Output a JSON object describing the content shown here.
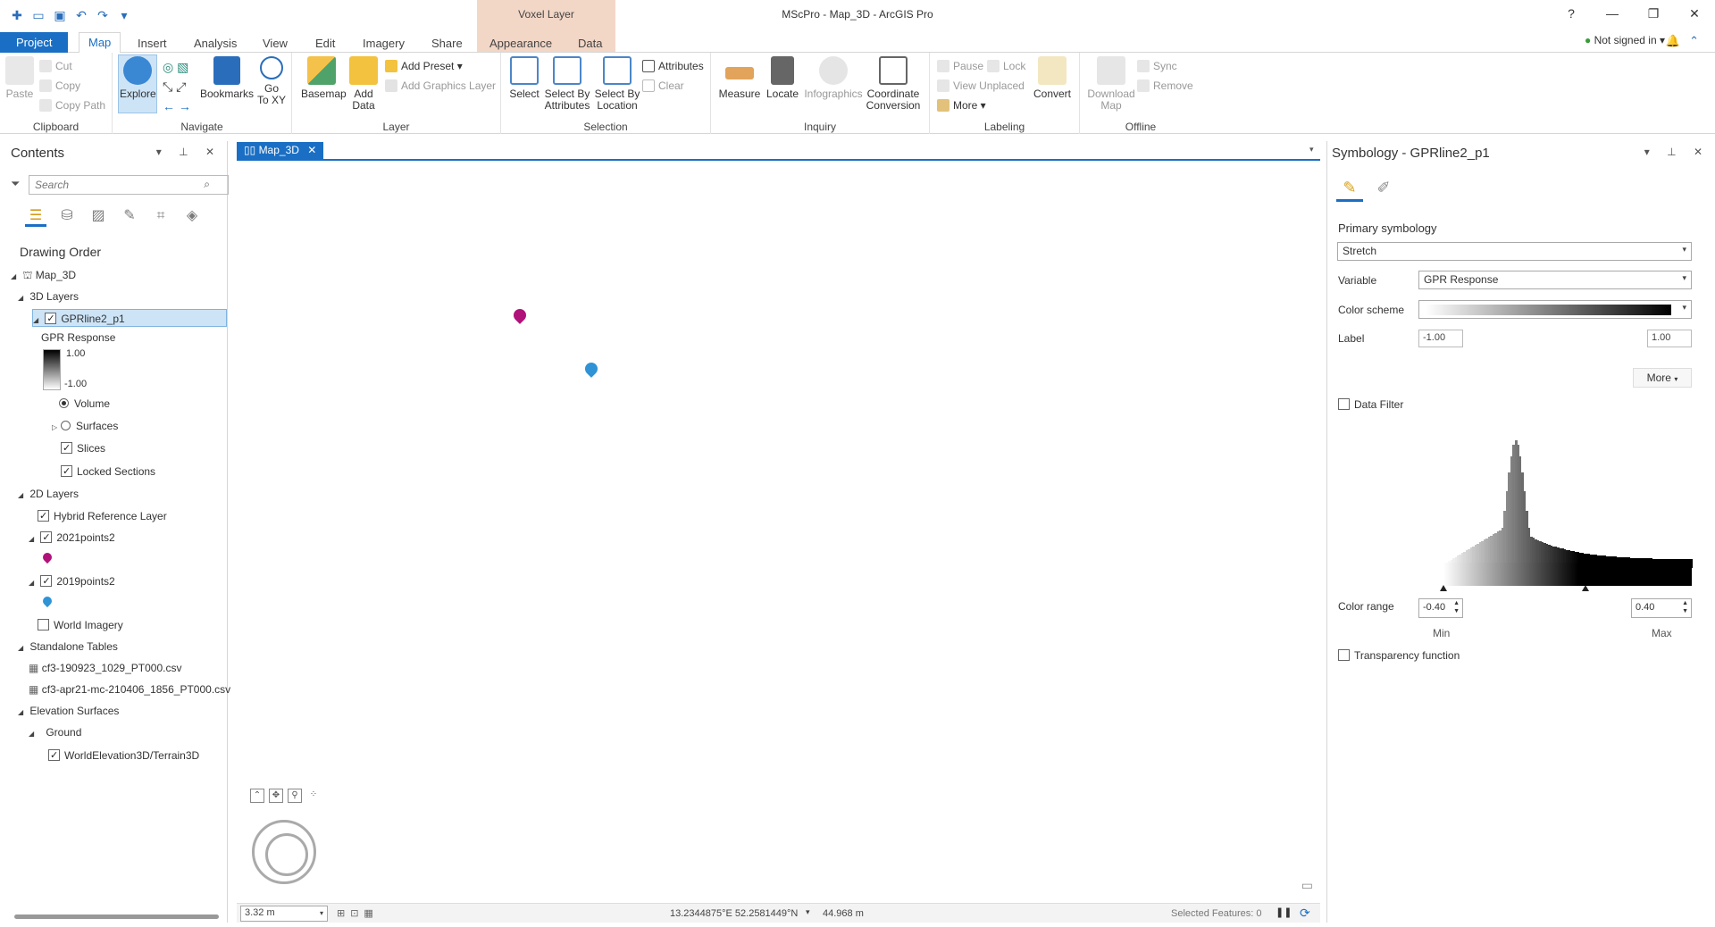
{
  "app": {
    "title": "MScPro - Map_3D - ArcGIS Pro",
    "contextual_tab_group": "Voxel Layer",
    "help": "?",
    "signin": "Not signed in",
    "signin_caret": "▾"
  },
  "tabs": [
    "Project",
    "Map",
    "Insert",
    "Analysis",
    "View",
    "Edit",
    "Imagery",
    "Share",
    "Appearance",
    "Data"
  ],
  "ribbon": {
    "clipboard": {
      "paste": "Paste",
      "cut": "Cut",
      "copy": "Copy",
      "copy_path": "Copy Path",
      "label": "Clipboard"
    },
    "navigate": {
      "explore": "Explore",
      "bookmarks": "Bookmarks",
      "go_to_xy_1": "Go",
      "go_to_xy_2": "To XY",
      "label": "Navigate"
    },
    "layer": {
      "basemap": "Basemap",
      "add_data_1": "Add",
      "add_data_2": "Data",
      "add_preset": "Add Preset",
      "add_graphics_layer": "Add Graphics Layer",
      "label": "Layer"
    },
    "selection": {
      "select": "Select",
      "select_by_attr_1": "Select By",
      "select_by_attr_2": "Attributes",
      "select_by_loc_1": "Select By",
      "select_by_loc_2": "Location",
      "attributes": "Attributes",
      "clear": "Clear",
      "label": "Selection"
    },
    "inquiry": {
      "measure": "Measure",
      "locate": "Locate",
      "infographics": "Infographics",
      "coord_conv_1": "Coordinate",
      "coord_conv_2": "Conversion",
      "label": "Inquiry"
    },
    "labeling": {
      "pause": "Pause",
      "lock": "Lock",
      "view_unplaced": "View Unplaced",
      "more": "More",
      "convert": "Convert",
      "label": "Labeling"
    },
    "offline": {
      "download_1": "Download",
      "download_2": "Map",
      "sync": "Sync",
      "remove": "Remove",
      "label": "Offline"
    }
  },
  "contents": {
    "title": "Contents",
    "search_placeholder": "Search",
    "drawing_order": "Drawing Order",
    "map": "Map_3D",
    "layers_3d": "3D Layers",
    "voxel_layer": "GPRline2_p1",
    "legend_title": "GPR Response",
    "legend_max": "1.00",
    "legend_min": "-1.00",
    "volume": "Volume",
    "surfaces": "Surfaces",
    "slices": "Slices",
    "locked_sections": "Locked Sections",
    "layers_2d": "2D Layers",
    "hybrid_ref": "Hybrid Reference Layer",
    "points_2021": "2021points2",
    "points_2019": "2019points2",
    "world_imagery": "World Imagery",
    "standalone_tables": "Standalone Tables",
    "table_1": "cf3-190923_1029_PT000.csv",
    "table_2": "cf3-apr21-mc-210406_1856_PT000.csv",
    "elevation_surfaces": "Elevation Surfaces",
    "ground": "Ground",
    "terrain": "WorldElevation3D/Terrain3D"
  },
  "map": {
    "tab": "Map_3D",
    "scale": "3.32 m",
    "coordinates": "13.2344875°E 52.2581449°N",
    "elevation": "44.968 m",
    "selected_features": "Selected Features: 0"
  },
  "symbology": {
    "title": "Symbology - GPRline2_p1",
    "primary_symbology": "Primary symbology",
    "method": "Stretch",
    "variable_label": "Variable",
    "variable": "GPR Response",
    "color_scheme_label": "Color scheme",
    "label_label": "Label",
    "label_min": "-1.00",
    "label_max": "1.00",
    "more": "More",
    "data_filter": "Data Filter",
    "color_range_label": "Color range",
    "range_min": "-0.40",
    "range_max": "0.40",
    "min": "Min",
    "max": "Max",
    "transparency": "Transparency function"
  },
  "colors": {
    "accent": "#1a6fc4",
    "pin_2021": "#b0127a",
    "pin_2019": "#2f93d6",
    "contextual": "#f2d6c6"
  }
}
